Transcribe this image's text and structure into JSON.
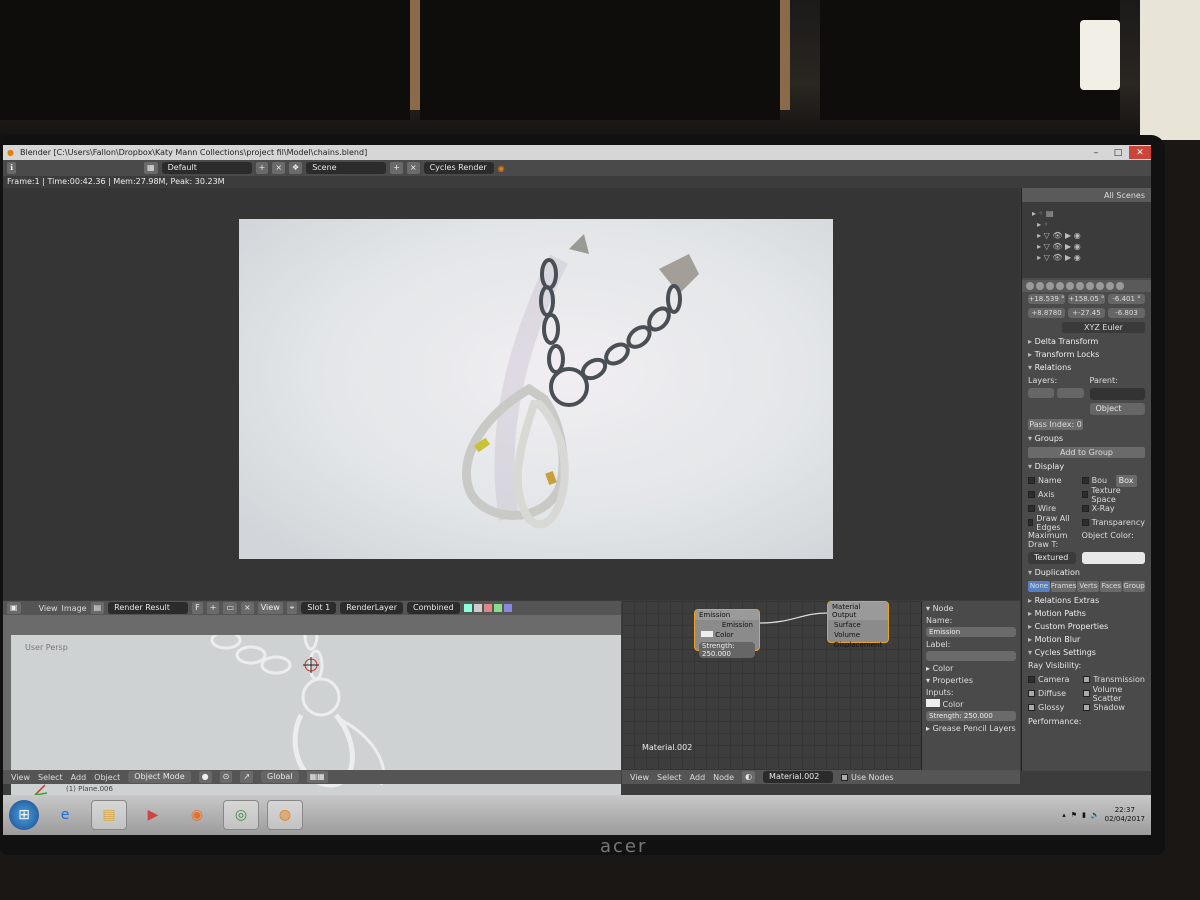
{
  "window": {
    "title": "Blender [C:\\Users\\Fallon\\Dropbox\\Katy Mann Collections\\project fil\\Model\\chains.blend]",
    "workspace": "Default",
    "scene": "Scene",
    "renderer": "Cycles Render"
  },
  "status_line": "Frame:1 | Time:00:42.36 | Mem:27.98M, Peak: 30.23M",
  "outliner": {
    "all_scenes": "All Scenes"
  },
  "properties": {
    "rotation_values": [
      "+18.539 °",
      "+158.05 °",
      "-6.401 °",
      "+8.8780",
      "+-27.45",
      "-6.803"
    ],
    "rotation_mode": "XYZ Euler",
    "sections_closed": [
      "Delta Transform",
      "Transform Locks"
    ],
    "relations": {
      "header": "Relations",
      "layers_label": "Layers:",
      "parent_label": "Parent:",
      "parent_type": "Object",
      "pass_index": "Pass Index: 0"
    },
    "groups": {
      "header": "Groups",
      "add_button": "Add to Group"
    },
    "display": {
      "header": "Display",
      "left_options": [
        "Name",
        "Axis",
        "Wire",
        "Draw All Edges"
      ],
      "right_options": [
        "Bou",
        "Texture Space",
        "X-Ray",
        "Transparency"
      ],
      "bounds_type": "Box",
      "max_draw_label": "Maximum Draw T:",
      "max_draw_value": "Textured",
      "object_color_label": "Object Color:"
    },
    "duplication": {
      "header": "Duplication",
      "tabs": [
        "None",
        "Frames",
        "Verts",
        "Faces",
        "Group"
      ],
      "active": "None"
    },
    "more_sections": [
      "Relations Extras",
      "Motion Paths",
      "Custom Properties",
      "Motion Blur"
    ],
    "cycles": {
      "header": "Cycles Settings",
      "ray_visibility": "Ray Visibility:",
      "left": [
        "Camera",
        "Diffuse",
        "Glossy"
      ],
      "right": [
        "Transmission",
        "Volume Scatter",
        "Shadow"
      ],
      "performance": "Performance:"
    }
  },
  "image_editor": {
    "menus": [
      "View",
      "Image"
    ],
    "image_name": "Render Result",
    "f_label": "F",
    "view": "View",
    "slot": "Slot 1",
    "layer": "RenderLayer",
    "pass": "Combined"
  },
  "viewport3d": {
    "label": "User Persp",
    "object_name": "(1) Plane.006",
    "menus": [
      "View",
      "Select",
      "Add",
      "Object"
    ],
    "mode": "Object Mode",
    "orientation": "Global"
  },
  "node_editor": {
    "emission_node": {
      "title": "Emission",
      "output": "Emission",
      "color_label": "Color",
      "strength": "Strength: 250.000"
    },
    "output_node": {
      "title": "Material Output",
      "inputs": [
        "Surface",
        "Volume",
        "Displacement"
      ]
    },
    "material_label": "Material.002",
    "menus": [
      "View",
      "Select",
      "Add",
      "Node"
    ],
    "material_field": "Material.002",
    "use_nodes": "Use Nodes"
  },
  "node_props": {
    "node_header": "Node",
    "name_label": "Name:",
    "name_value": "Emission",
    "label_label": "Label:",
    "color_section": "Color",
    "properties_section": "Properties",
    "inputs_label": "Inputs:",
    "color_label": "Color",
    "strength": "Strength:",
    "strength_value": "250.000",
    "grease_pencil": "Grease Pencil Layers"
  },
  "taskbar": {
    "time": "22:37",
    "date": "02/04/2017"
  },
  "monitor_brand": "acer"
}
